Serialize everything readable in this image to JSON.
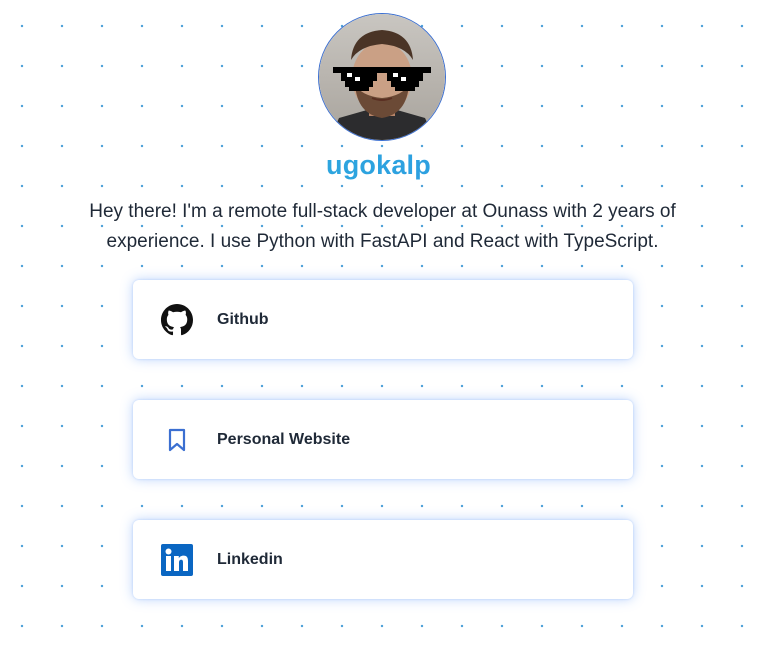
{
  "profile": {
    "username": "ugokalp",
    "bio": "Hey there! I'm a remote full-stack developer at Ounass with 2 years of experience. I use Python with FastAPI and React with TypeScript.",
    "avatar_icon": "profile-photo"
  },
  "links": [
    {
      "label": "Github",
      "icon": "github-icon"
    },
    {
      "label": "Personal Website",
      "icon": "bookmark-icon"
    },
    {
      "label": "Linkedin",
      "icon": "linkedin-icon"
    }
  ],
  "colors": {
    "accent_start": "#2fb6d9",
    "accent_end": "#2b8fe6",
    "dot": "#4a9fd8",
    "card_glow": "#3b82f6",
    "linkedin": "#0a66c2",
    "bookmark": "#3b6fd1",
    "text": "#1f2937"
  }
}
